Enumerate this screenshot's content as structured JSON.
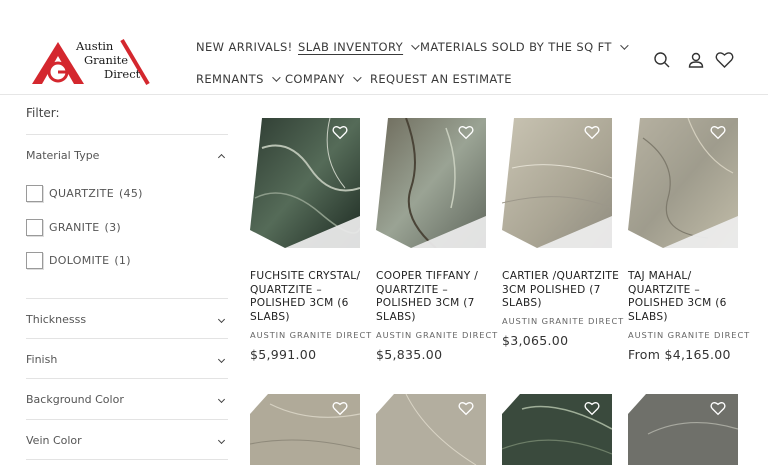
{
  "brand": {
    "logo_line1": "Austin",
    "logo_line2": "Granite",
    "logo_line3": "Direct",
    "accent": "#d4272e"
  },
  "nav": [
    {
      "label": "NEW ARRIVALS!",
      "has_dropdown": false,
      "active": false
    },
    {
      "label": "SLAB INVENTORY",
      "has_dropdown": true,
      "active": true
    },
    {
      "label": "MATERIALS SOLD BY THE SQ FT",
      "has_dropdown": true,
      "active": false
    },
    {
      "label": "REMNANTS",
      "has_dropdown": true,
      "active": false
    },
    {
      "label": "COMPANY",
      "has_dropdown": true,
      "active": false
    },
    {
      "label": "REQUEST AN ESTIMATE",
      "has_dropdown": false,
      "active": false
    }
  ],
  "header_icons": [
    "search-icon",
    "account-icon",
    "wishlist-heart-icon"
  ],
  "filters": {
    "title": "Filter:",
    "material_type": {
      "label": "Material Type",
      "expanded": true,
      "options": [
        {
          "label": "QUARTZITE",
          "count": "(45)"
        },
        {
          "label": "GRANITE",
          "count": "(3)"
        },
        {
          "label": "DOLOMITE",
          "count": "(1)"
        }
      ]
    },
    "collapsed": [
      "Thicknesss",
      "Finish",
      "Background Color",
      "Vein Color"
    ]
  },
  "products": [
    {
      "title": "FUCHSITE CRYSTAL/ QUARTZITE – POLISHED 3CM (6 SLABS)",
      "vendor": "AUSTIN GRANITE DIRECT",
      "price": "$5,991.00"
    },
    {
      "title": "COOPER TIFFANY / QUARTZITE – POLISHED 3CM (7 SLABS)",
      "vendor": "AUSTIN GRANITE DIRECT",
      "price": "$5,835.00"
    },
    {
      "title": "CARTIER /QUARTZITE 3CM POLISHED (7 SLABS)",
      "vendor": "AUSTIN GRANITE DIRECT",
      "price": "$3,065.00"
    },
    {
      "title": "TAJ MAHAL/ QUARTZITE – POLISHED 3CM (6 SLABS)",
      "vendor": "AUSTIN GRANITE DIRECT",
      "price": "From $4,165.00"
    }
  ]
}
